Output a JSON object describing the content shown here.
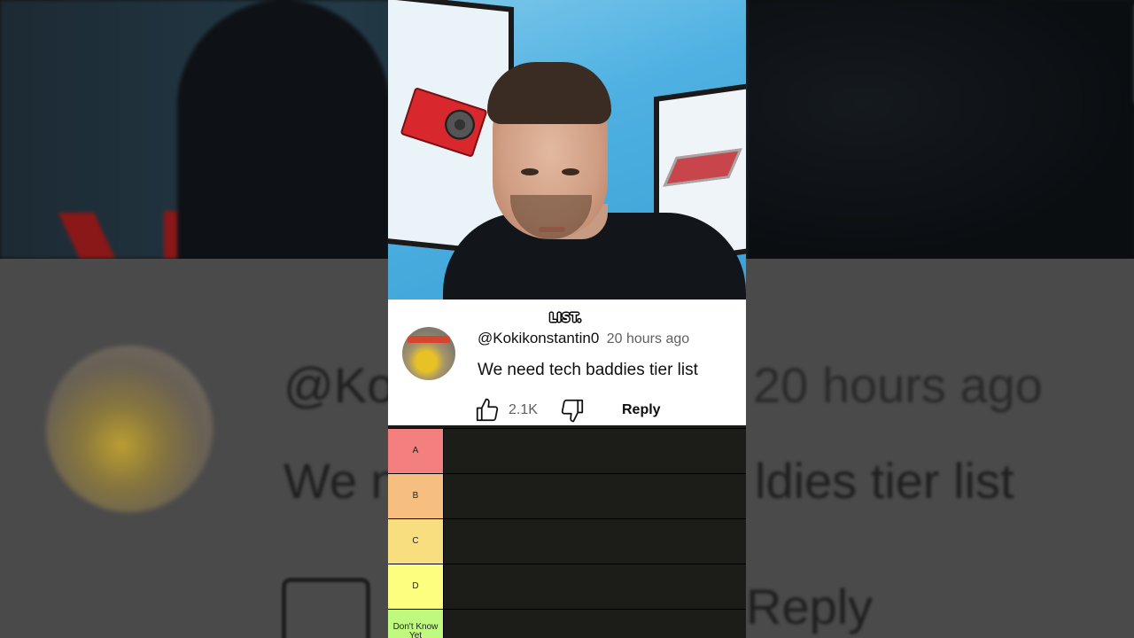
{
  "caption": "LIST.",
  "comment": {
    "username": "@Kokikonstantin0",
    "time": "20 hours ago",
    "text": "We need tech baddies tier list",
    "likes": "2.1K",
    "reply_label": "Reply",
    "icons": {
      "like": "thumbs-up-icon",
      "dislike": "thumbs-down-icon"
    }
  },
  "background": {
    "username_fragment": "@Ko",
    "time": "20 hours ago",
    "text_left": "We n",
    "text_right": "ldies tier list",
    "reply_label": "Reply"
  },
  "tiers": [
    {
      "label": "A",
      "color": "#f47f7f"
    },
    {
      "label": "B",
      "color": "#f7bf7f"
    },
    {
      "label": "C",
      "color": "#f9de7f"
    },
    {
      "label": "D",
      "color": "#fdfe7f"
    },
    {
      "label": "Don't Know Yet",
      "color": "#bff97f"
    }
  ]
}
